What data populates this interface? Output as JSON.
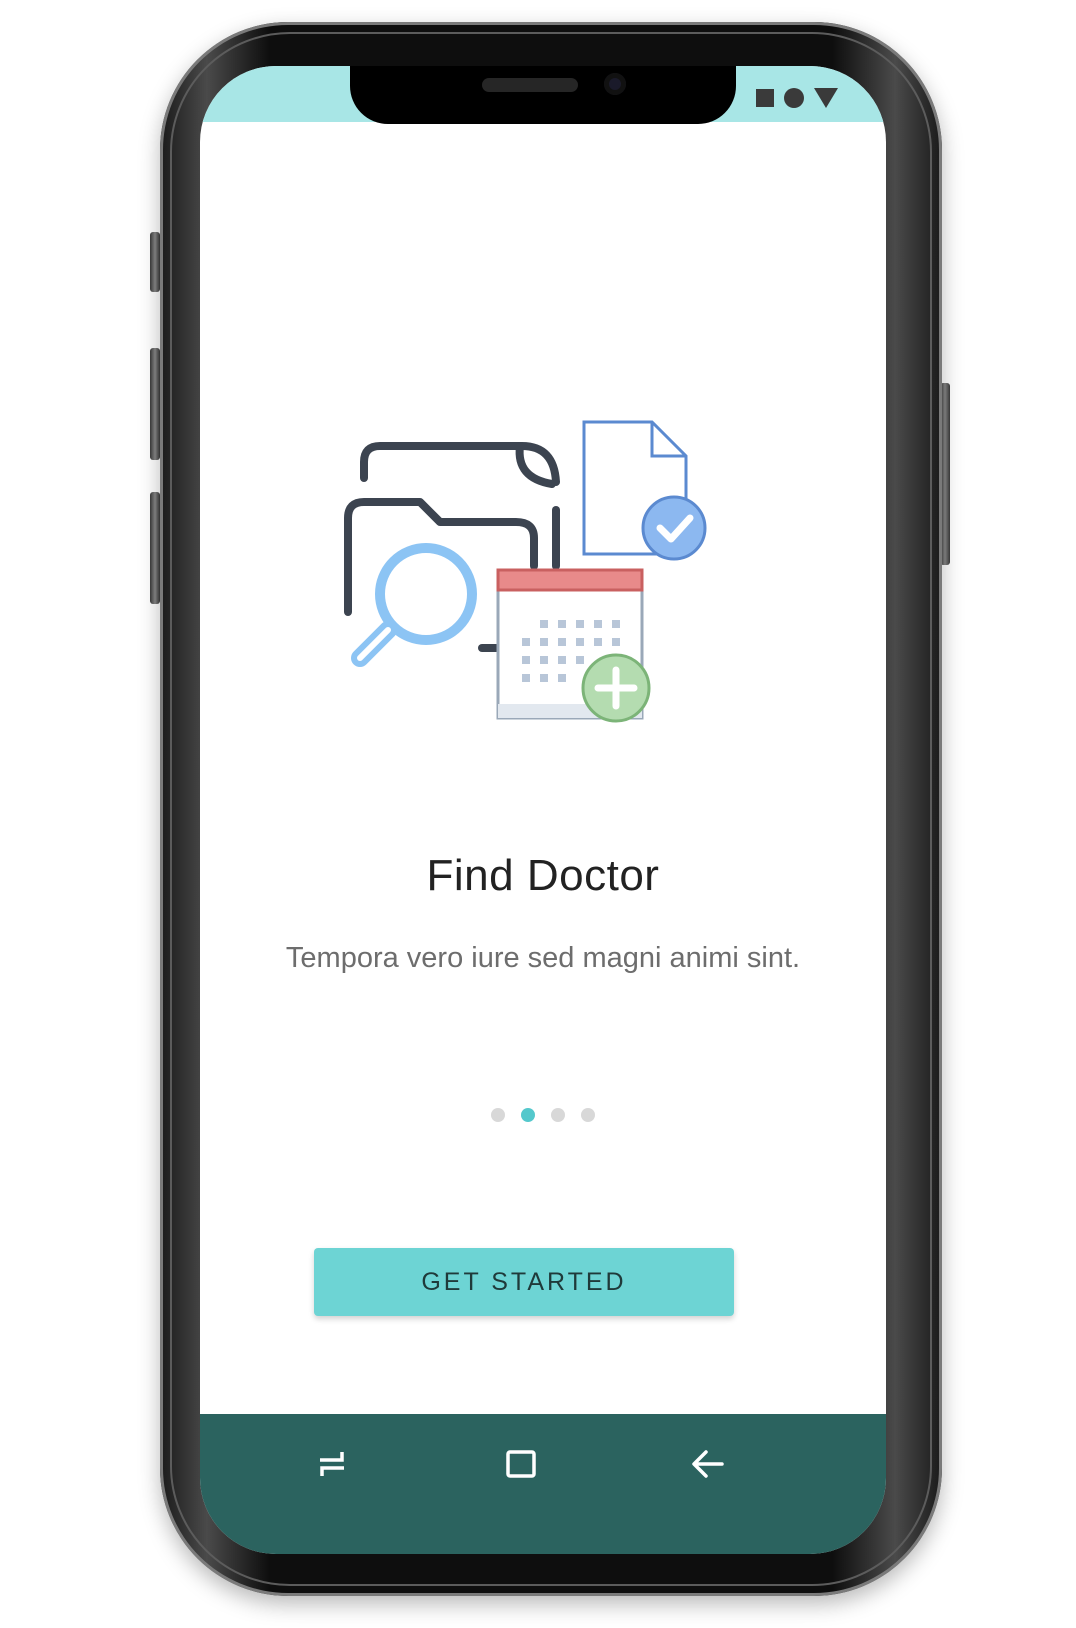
{
  "onboarding": {
    "title": "Find Doctor",
    "description": "Tempora vero iure sed magni animi sint.",
    "pagination": {
      "total": 4,
      "active_index": 1
    },
    "cta_label": "GET STARTED",
    "illustration_icons": [
      "folder-icon",
      "magnifier-icon",
      "document-icon",
      "check-badge-icon",
      "calendar-icon",
      "add-badge-icon"
    ]
  },
  "status_bar": {
    "icons": [
      "square-icon",
      "circle-icon",
      "triangle-icon"
    ],
    "color": "#a8e6e6"
  },
  "nav_bar": {
    "buttons": [
      "recents-icon",
      "home-icon",
      "back-icon"
    ],
    "color": "#2b635f"
  },
  "theme": {
    "accent": "#6dd4d4",
    "dot_active": "#54c8cc",
    "dot_inactive": "#d8d8d8"
  }
}
